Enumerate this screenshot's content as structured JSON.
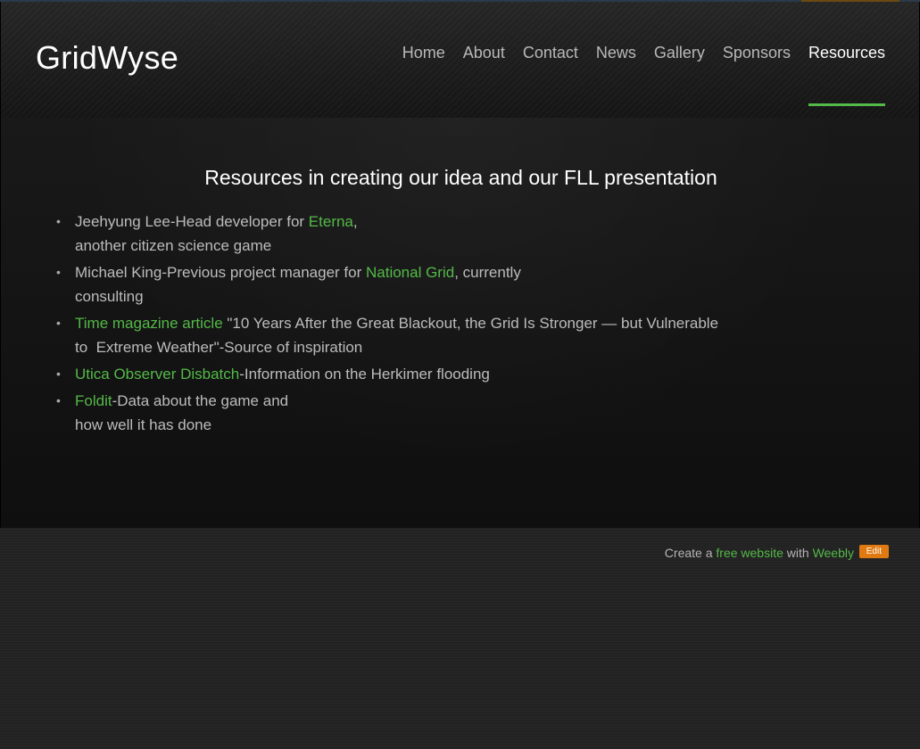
{
  "site": {
    "title": "GridWyse"
  },
  "nav": {
    "items": [
      {
        "label": "Home"
      },
      {
        "label": "About"
      },
      {
        "label": "Contact"
      },
      {
        "label": "News"
      },
      {
        "label": "Gallery"
      },
      {
        "label": "Sponsors"
      },
      {
        "label": "Resources",
        "active": true
      }
    ]
  },
  "main": {
    "title": "Resources in creating our idea and our FLL presentation",
    "items": [
      {
        "pre": "Jeehyung Lee-Head developer for ",
        "link": "Eterna",
        "post": ",",
        "line2": "another citizen science game"
      },
      {
        "pre": "Michael King-Previous project manager for ",
        "link": "National Grid",
        "post": ", currently",
        "line2": "consulting"
      },
      {
        "pre": "",
        "link": "Time magazine article",
        "post": " \"10 Years After the Great Blackout, the Grid Is Stronger — but Vulnerable",
        "line2": "to  Extreme Weather\"-Source of inspiration"
      },
      {
        "pre": "",
        "link": "Utica Observer Disbatch",
        "post": "-Information on the Herkimer flooding",
        "line2": ""
      },
      {
        "pre": "",
        "link": "Foldit",
        "post": "-Data about the game and",
        "line2": "how well it has done"
      }
    ]
  },
  "footer": {
    "create": "Create a",
    "free_website": "free website",
    "with": "with",
    "weebly": "Weebly",
    "edit": "Edit"
  },
  "colors": {
    "accent_green": "#54b948",
    "edit_orange": "#e07a10"
  }
}
